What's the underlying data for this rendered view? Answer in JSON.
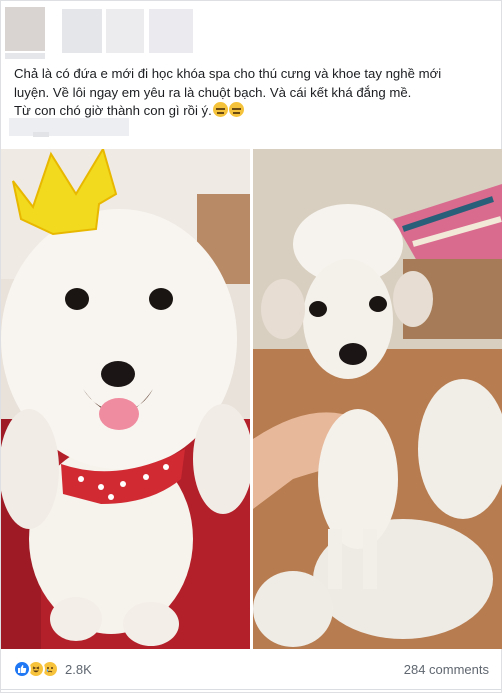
{
  "post": {
    "text_lines": [
      "Chả là có đứa e mới đi học khóa spa cho thú cưng và khoe tay nghề mới",
      "luyện. Về lôi ngay em yêu ra là chuột bạch. Và cái kết khá đắng mề.",
      "Từ con chó giờ thành con gì rồi ý."
    ],
    "emojis": [
      "unamused-face",
      "unamused-face"
    ]
  },
  "images": [
    {
      "name": "white-poodle-with-crown",
      "description_icon": "crown-icon"
    },
    {
      "name": "shaved-poodle-with-fur-pile"
    }
  ],
  "footer": {
    "reaction_icons": [
      "like-icon",
      "haha-icon",
      "sad-icon"
    ],
    "reaction_count": "2.8K",
    "comments_label": "284 comments"
  },
  "colors": {
    "like_blue": "#2078f4",
    "emoji_yellow": "#f5c33b",
    "muted_text": "#606770"
  }
}
